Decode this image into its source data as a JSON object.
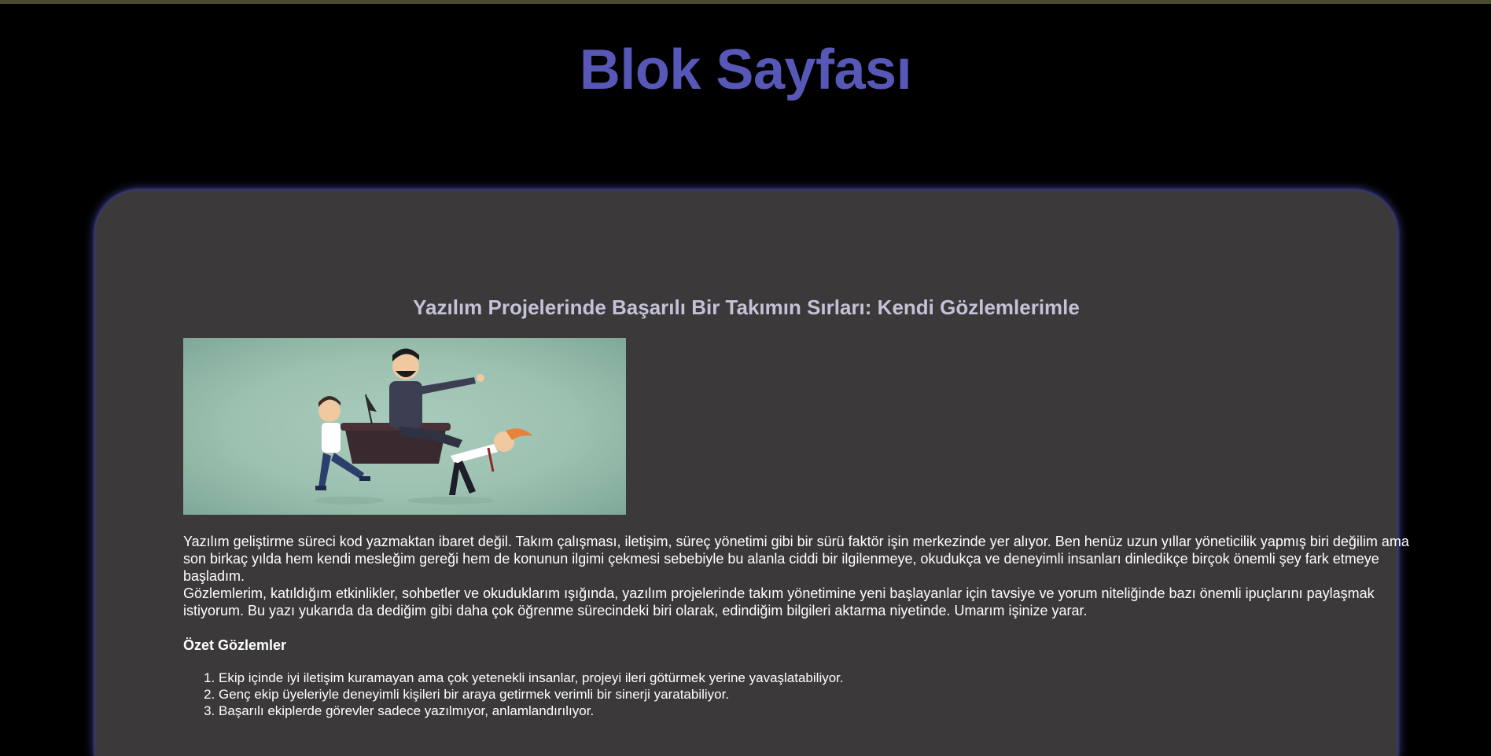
{
  "header": {
    "site_title": "Blok Sayfası"
  },
  "post": {
    "title": "Yazılım Projelerinde Başarılı Bir Takımın Sırları: Kendi Gözlemlerimle",
    "image_icon": "team-leadership-illustration",
    "paragraph_1": "Yazılım geliştirme süreci kod yazmaktan ibaret değil. Takım çalışması, iletişim, süreç yönetimi gibi bir sürü faktör işin merkezinde yer alıyor. Ben henüz uzun yıllar yöneticilik yapmış biri değilim ama son birkaç yılda hem kendi mesleğim gereği hem de konunun ilgimi çekmesi sebebiyle bu alanla ciddi bir ilgilenmeye, okudukça ve deneyimli insanları dinledikçe birçok önemli şey fark etmeye başladım.",
    "paragraph_2": "Gözlemlerim, katıldığım etkinlikler, sohbetler ve okuduklarım ışığında, yazılım projelerinde takım yönetimine yeni başlayanlar için tavsiye ve yorum niteliğinde bazı önemli ipuçlarını paylaşmak istiyorum. Bu yazı yukarıda da dediğim gibi daha çok öğrenme sürecindeki biri olarak, edindiğim bilgileri aktarma niyetinde. Umarım işinize yarar.",
    "summary_heading": "Özet Gözlemler",
    "observations": [
      "Ekip içinde iyi iletişim kuramayan ama çok yetenekli insanlar, projeyi ileri götürmek yerine yavaşlatabiliyor.",
      "Genç ekip üyeleriyle deneyimli kişileri bir araya getirmek verimli bir sinerji yaratabiliyor.",
      "Başarılı ekiplerde görevler sadece yazılmıyor, anlamlandırılıyor."
    ]
  },
  "colors": {
    "page_background": "#000000",
    "title": "#5757b8",
    "card_background": "#3b393a",
    "card_glow": "#3b3a8a",
    "post_title": "#c4c2d6"
  }
}
